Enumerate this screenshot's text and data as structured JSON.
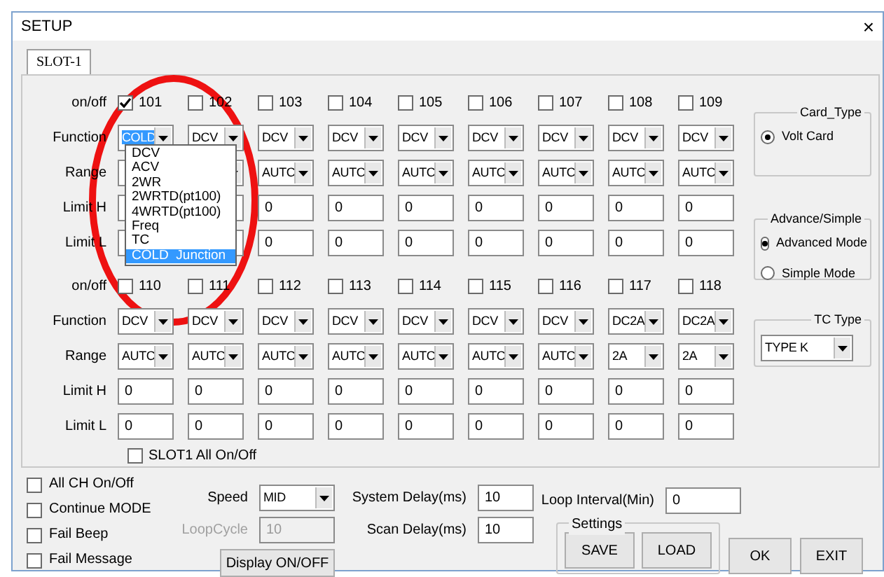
{
  "window": {
    "title": "SETUP",
    "close": "×"
  },
  "tabs": [
    {
      "label": "SLOT-1",
      "selected": true
    }
  ],
  "blocks": [
    {
      "row_labels": {
        "onoff": "on/off",
        "function": "Function",
        "range": "Range",
        "limit_h": "Limit H",
        "limit_l": "Limit L"
      },
      "channels": [
        {
          "name": "101",
          "checked": true,
          "function": "COLD",
          "function_highlighted": true
        },
        {
          "name": "102",
          "checked": false,
          "function": "DCV"
        },
        {
          "name": "103",
          "checked": false,
          "function": "DCV",
          "range": "AUTC",
          "limit_h": "0",
          "limit_l": "0"
        },
        {
          "name": "104",
          "checked": false,
          "function": "DCV",
          "range": "AUTC",
          "limit_h": "0",
          "limit_l": "0"
        },
        {
          "name": "105",
          "checked": false,
          "function": "DCV",
          "range": "AUTC",
          "limit_h": "0",
          "limit_l": "0"
        },
        {
          "name": "106",
          "checked": false,
          "function": "DCV",
          "range": "AUTC",
          "limit_h": "0",
          "limit_l": "0"
        },
        {
          "name": "107",
          "checked": false,
          "function": "DCV",
          "range": "AUTC",
          "limit_h": "0",
          "limit_l": "0"
        },
        {
          "name": "108",
          "checked": false,
          "function": "DCV",
          "range": "AUTC",
          "limit_h": "0",
          "limit_l": "0"
        },
        {
          "name": "109",
          "checked": false,
          "function": "DCV",
          "range": "AUTC",
          "limit_h": "0",
          "limit_l": "0"
        }
      ]
    },
    {
      "row_labels": {
        "onoff": "on/off",
        "function": "Function",
        "range": "Range",
        "limit_h": "Limit H",
        "limit_l": "Limit L"
      },
      "channels": [
        {
          "name": "110",
          "checked": false,
          "function": "DCV",
          "range": "AUTC",
          "limit_h": "0",
          "limit_l": "0"
        },
        {
          "name": "111",
          "checked": false,
          "function": "DCV",
          "range": "AUTC",
          "limit_h": "0",
          "limit_l": "0"
        },
        {
          "name": "112",
          "checked": false,
          "function": "DCV",
          "range": "AUTC",
          "limit_h": "0",
          "limit_l": "0"
        },
        {
          "name": "113",
          "checked": false,
          "function": "DCV",
          "range": "AUTC",
          "limit_h": "0",
          "limit_l": "0"
        },
        {
          "name": "114",
          "checked": false,
          "function": "DCV",
          "range": "AUTC",
          "limit_h": "0",
          "limit_l": "0"
        },
        {
          "name": "115",
          "checked": false,
          "function": "DCV",
          "range": "AUTC",
          "limit_h": "0",
          "limit_l": "0"
        },
        {
          "name": "116",
          "checked": false,
          "function": "DCV",
          "range": "AUTC",
          "limit_h": "0",
          "limit_l": "0"
        },
        {
          "name": "117",
          "checked": false,
          "function": "DC2A",
          "range": "2A",
          "limit_h": "0",
          "limit_l": "0"
        },
        {
          "name": "118",
          "checked": false,
          "function": "DC2A",
          "range": "2A",
          "limit_h": "0",
          "limit_l": "0"
        }
      ]
    }
  ],
  "function_dropdown": {
    "items": [
      {
        "label": "DCV",
        "selected": false
      },
      {
        "label": "ACV",
        "selected": false
      },
      {
        "label": "2WR",
        "selected": false
      },
      {
        "label": "2WRTD(pt100)",
        "selected": false
      },
      {
        "label": "4WRTD(pt100)",
        "selected": false
      },
      {
        "label": "Freq",
        "selected": false
      },
      {
        "label": "TC",
        "selected": false
      },
      {
        "label": "COLD  Junction",
        "selected": true
      }
    ]
  },
  "slot_all": {
    "label": "SLOT1 All On/Off",
    "checked": false
  },
  "card_type": {
    "title": "Card_Type",
    "options": [
      {
        "label": "Volt Card",
        "selected": true
      }
    ]
  },
  "mode": {
    "title": "Advance/Simple",
    "options": [
      {
        "label": "Advanced Mode",
        "selected": true
      },
      {
        "label": "Simple Mode",
        "selected": false
      }
    ]
  },
  "tc_type": {
    "title": "TC Type",
    "value": "TYPE K"
  },
  "options": [
    {
      "label": "All CH On/Off",
      "checked": false
    },
    {
      "label": "Continue MODE",
      "checked": false
    },
    {
      "label": "Fail Beep",
      "checked": false
    },
    {
      "label": "Fail Message",
      "checked": false
    }
  ],
  "speed": {
    "label": "Speed",
    "value": "MID"
  },
  "loop_cycle": {
    "label": "LoopCycle",
    "value": "10",
    "disabled": true
  },
  "display_button": "Display ON/OFF",
  "system_delay": {
    "label": "System Delay(ms)",
    "value": "10"
  },
  "scan_delay": {
    "label": "Scan Delay(ms)",
    "value": "10"
  },
  "loop_interval": {
    "label": "Loop Interval(Min)",
    "value": "0"
  },
  "settings": {
    "title": "Settings",
    "buttons": [
      "SAVE",
      "LOAD"
    ]
  },
  "buttons": [
    "OK",
    "EXIT"
  ]
}
